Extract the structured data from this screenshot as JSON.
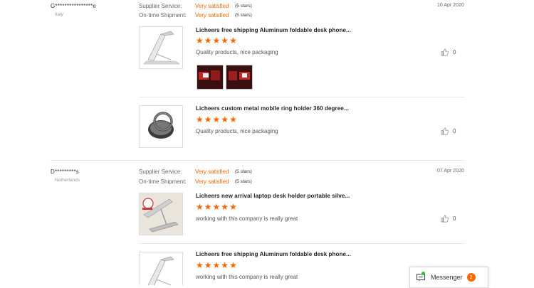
{
  "reviews": [
    {
      "buyer": "G****************e",
      "country": "Italy",
      "date": "10 Apr 2020",
      "supplier_label": "Supplier Service:",
      "supplier_value": "Very satisfied",
      "supplier_stars": "(5 stars)",
      "shipment_label": "On-time Shipment:",
      "shipment_value": "Very satisfied",
      "shipment_stars": "(5 stars)",
      "products": [
        {
          "title": "Licheers free shipping Aluminum foldable desk phone...",
          "rating": 5,
          "comment": "Quality products, nice packaging",
          "likes": "0",
          "image": "folding-phone-stand"
        },
        {
          "title": "Licheers custom metal mobile ring holder 360 degree...",
          "rating": 5,
          "comment": "Quality products, nice packaging",
          "likes": "0",
          "image": "ring-holder"
        }
      ]
    },
    {
      "buyer": "D*********s",
      "country": "Netherlands",
      "date": "07 Apr 2020",
      "supplier_label": "Supplier Service:",
      "supplier_value": "Very satisfied",
      "supplier_stars": "(5 stars)",
      "shipment_label": "On-time Shipment:",
      "shipment_value": "Very satisfied",
      "shipment_stars": "(5 stars)",
      "products": [
        {
          "title": "Licheers new arrival laptop desk holder portable silve...",
          "rating": 5,
          "comment": "working with this company is really great",
          "likes": "0",
          "image": "laptop-stand"
        },
        {
          "title": "Licheers free shipping Aluminum foldable desk phone...",
          "rating": 5,
          "comment": "working with this company is really great",
          "likes": "",
          "image": "folding-phone-stand"
        }
      ]
    }
  ],
  "messenger": {
    "label": "Messenger",
    "count": "2"
  },
  "icons": {
    "like": "thumbs-up-icon",
    "chat": "chat-icon"
  },
  "colors": {
    "accent": "#ff6600"
  }
}
